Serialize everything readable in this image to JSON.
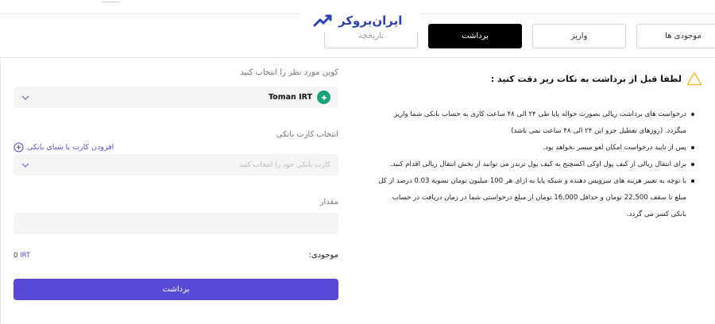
{
  "brand": {
    "logo_text": "ایران‌بروکر",
    "color": "#2d3fbf"
  },
  "tabs": [
    {
      "label": "موجودی ها",
      "state": "normal"
    },
    {
      "label": "واریز",
      "state": "normal"
    },
    {
      "label": "برداشت",
      "state": "active"
    },
    {
      "label": "تاریخچه",
      "state": "faded"
    }
  ],
  "notice": {
    "title": "لطفا قبل از برداشت به نکات زیر دقت کنید :",
    "items": [
      "درخواست های برداشت ریالی بصورت حواله پایا طی ۲۴ الی ۴۸ ساعت کاری به حساب بانکی شما واریز میگردد. (روزهای تعطیل جزو این ۲۴ الی ۴۸ ساعت نمی باشد)",
      "پس از تایید درخواست امکان لغو میسر نخواهد بود.",
      "برای انتقال ریالی از کیف پول اوکی اکسچنج به کیف پول تریدر می توانید از بخش انتقال ریالی اقدام کنید.",
      "با توجه به تغییر هزینه های سرویس دهنده و شبکه پایا به ازای هر 100 میلیون تومان تسویه 0.03 درصد از کل مبلغ تا سقف 22,500 تومان و حداقل 16,000 تومان از مبلغ درخواستی شما در زمان دریافت در حساب بانکی کسر می گردد."
    ]
  },
  "form": {
    "coin_label": "کوین مورد نظر را انتخاب کنید",
    "coin_value": "Toman IRT",
    "bank_label": "انتخاب کارت بانکی",
    "add_bank_label": "افزودن کارت یا شبای بانکی",
    "bank_placeholder": "کارت بانکی خود را انتخاب کنید",
    "amount_label": "مقدار",
    "amount_value": "",
    "balance_label": "موجودی:",
    "balance_amount": "0",
    "balance_currency": "IRT",
    "submit_label": "برداشت"
  },
  "colors": {
    "accent": "#5849d6",
    "coin_badge": "#1aa37a",
    "warning": "#f2c230"
  }
}
